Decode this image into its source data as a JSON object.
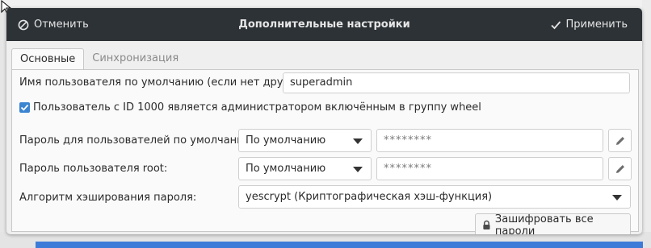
{
  "dialog": {
    "title": "Дополнительные настройки",
    "cancel_label": "Отменить",
    "apply_label": "Применить"
  },
  "tabs": [
    {
      "label": "Основные",
      "active": true
    },
    {
      "label": "Синхронизация",
      "active": false
    }
  ],
  "form": {
    "default_user": {
      "label": "Имя пользователя по умолчанию (если нет других):",
      "value": "superadmin"
    },
    "wheel_admin": {
      "label": "Пользователь с ID 1000 является администратором включённым в группу wheel",
      "checked": true
    },
    "default_user_password": {
      "label": "Пароль для пользователей по умолчанию:",
      "mode": "По умолчанию",
      "value": "********"
    },
    "root_password": {
      "label": "Пароль пользователя root:",
      "mode": "По умолчанию",
      "value": "********"
    },
    "hash_algorithm": {
      "label": "Алгоритм хэширования пароля:",
      "value": "yescrypt (Криптографическая хэш-функция)"
    },
    "encrypt_all_label": "Зашифровать все пароли"
  },
  "icons": {
    "cancel": "cancel-circle-icon",
    "apply": "checkmark-icon",
    "edit": "pencil-icon",
    "lock": "lock-icon",
    "dropdown": "chevron-down-icon"
  },
  "colors": {
    "header_bg": "#2d3236",
    "accent": "#3b84d1",
    "panel_bg": "#fafafa"
  }
}
